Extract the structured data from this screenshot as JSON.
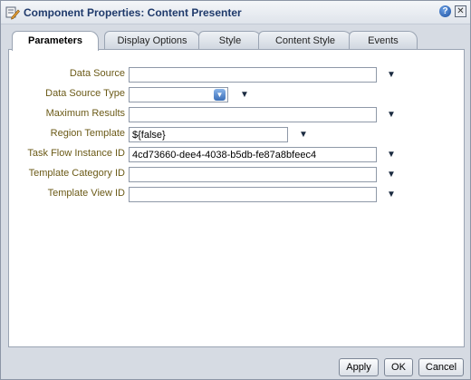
{
  "dialog": {
    "title": "Component Properties: Content Presenter",
    "help_label": "?",
    "close_label": "✕"
  },
  "tabs": [
    {
      "label": "Parameters",
      "active": true
    },
    {
      "label": "Display Options",
      "active": false
    },
    {
      "label": "Style",
      "active": false
    },
    {
      "label": "Content Style",
      "active": false
    },
    {
      "label": "Events",
      "active": false
    }
  ],
  "fields": [
    {
      "label": "Data Source",
      "value": ""
    },
    {
      "label": "Data Source Type",
      "value": "",
      "kind": "select"
    },
    {
      "label": "Maximum Results",
      "value": ""
    },
    {
      "label": "Region Template",
      "value": "${false}"
    },
    {
      "label": "Task Flow Instance ID",
      "value": "4cd73660-dee4-4038-b5db-fe87a8bfeec4"
    },
    {
      "label": "Template Category ID",
      "value": ""
    },
    {
      "label": "Template View ID",
      "value": ""
    }
  ],
  "buttons": {
    "apply": "Apply",
    "ok": "OK",
    "cancel": "Cancel"
  },
  "icons": {
    "title": "edit-properties-icon",
    "field_menu": "chevron-down-icon",
    "select_arrow": "select-arrow-icon"
  },
  "colors": {
    "label_text": "#6b5a17",
    "title_text": "#1f3a6b",
    "dialog_bg": "#d6dbe3"
  }
}
